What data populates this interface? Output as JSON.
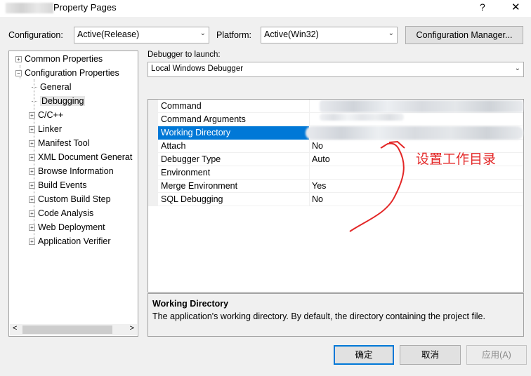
{
  "window": {
    "title": "Property Pages",
    "help_glyph": "?",
    "close_glyph": "✕"
  },
  "config_bar": {
    "configuration_label": "Configuration:",
    "configuration_value": "Active(Release)",
    "platform_label": "Platform:",
    "platform_value": "Active(Win32)",
    "manager_button": "Configuration Manager..."
  },
  "debugger": {
    "label": "Debugger to launch:",
    "value": "Local Windows Debugger"
  },
  "tree": {
    "items": [
      {
        "label": "Common Properties",
        "expander": "+"
      },
      {
        "label": "Configuration Properties",
        "expander": "−"
      },
      {
        "label": "General"
      },
      {
        "label": "Debugging"
      },
      {
        "label": "C/C++",
        "expander": "+"
      },
      {
        "label": "Linker",
        "expander": "+"
      },
      {
        "label": "Manifest Tool",
        "expander": "+"
      },
      {
        "label": "XML Document Generat",
        "expander": "+"
      },
      {
        "label": "Browse Information",
        "expander": "+"
      },
      {
        "label": "Build Events",
        "expander": "+"
      },
      {
        "label": "Custom Build Step",
        "expander": "+"
      },
      {
        "label": "Code Analysis",
        "expander": "+"
      },
      {
        "label": "Web Deployment",
        "expander": "+"
      },
      {
        "label": "Application Verifier",
        "expander": "+"
      }
    ],
    "scroll_left": "<",
    "scroll_right": ">"
  },
  "grid": {
    "rows": [
      {
        "name": "Command",
        "value": ""
      },
      {
        "name": "Command Arguments",
        "value": ""
      },
      {
        "name": "Working Directory",
        "value": ""
      },
      {
        "name": "Attach",
        "value": "No"
      },
      {
        "name": "Debugger Type",
        "value": "Auto"
      },
      {
        "name": "Environment",
        "value": ""
      },
      {
        "name": "Merge Environment",
        "value": "Yes"
      },
      {
        "name": "SQL Debugging",
        "value": "No"
      }
    ]
  },
  "description": {
    "title": "Working Directory",
    "text": "The application's working directory.  By default, the directory containing the project file."
  },
  "annotation": {
    "text": "设置工作目录",
    "color": "#e32626"
  },
  "buttons": {
    "ok": "确定",
    "cancel": "取消",
    "apply": "应用(A)"
  },
  "colors": {
    "selection": "#0078d7",
    "dialog_bg": "#f0f0f0"
  }
}
